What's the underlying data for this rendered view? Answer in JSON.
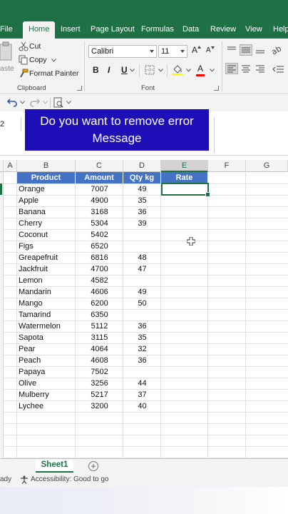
{
  "tabs": [
    "File",
    "Home",
    "Insert",
    "Page Layout",
    "Formulas",
    "Data",
    "Review",
    "View",
    "Help"
  ],
  "ribbon": {
    "clipboard": {
      "paste_label": "aste",
      "cut_label": "Cut",
      "copy_label": "Copy",
      "format_painter_label": "Format Painter",
      "group_label": "Clipboard"
    },
    "font": {
      "font_name": "Calibri",
      "font_size": "11",
      "bold": "B",
      "italic": "I",
      "underline": "U",
      "grow_label": "A",
      "shrink_label": "A",
      "font_color_label": "A",
      "group_label": "Font"
    }
  },
  "formula_bar": {
    "name_box": "2"
  },
  "banner": {
    "line1": "Do  you want to remove error",
    "line2": "Message"
  },
  "grid": {
    "columns": [
      "A",
      "B",
      "C",
      "D",
      "E",
      "F",
      "G"
    ],
    "selected_column": "E",
    "headers": [
      "Product",
      "Amount",
      "Qty kg",
      "Rate"
    ],
    "rows": [
      {
        "product": "Orange",
        "amount": "7007",
        "qty": "49"
      },
      {
        "product": "Apple",
        "amount": "4900",
        "qty": "35"
      },
      {
        "product": "Banana",
        "amount": "3168",
        "qty": "36"
      },
      {
        "product": "Cherry",
        "amount": "5304",
        "qty": "39"
      },
      {
        "product": "Coconut",
        "amount": "5402",
        "qty": ""
      },
      {
        "product": "Figs",
        "amount": "6520",
        "qty": ""
      },
      {
        "product": "Greapefruit",
        "amount": "6816",
        "qty": "48"
      },
      {
        "product": "Jackfruit",
        "amount": "4700",
        "qty": "47"
      },
      {
        "product": "Lemon",
        "amount": "4582",
        "qty": ""
      },
      {
        "product": "Mandarin",
        "amount": "4606",
        "qty": "49"
      },
      {
        "product": "Mango",
        "amount": "6200",
        "qty": "50"
      },
      {
        "product": "Tamarind",
        "amount": "6350",
        "qty": ""
      },
      {
        "product": "Watermelon",
        "amount": "5112",
        "qty": "36"
      },
      {
        "product": "Sapota",
        "amount": "3115",
        "qty": "35"
      },
      {
        "product": "Pear",
        "amount": "4064",
        "qty": "32"
      },
      {
        "product": "Peach",
        "amount": "4608",
        "qty": "36"
      },
      {
        "product": "Papaya",
        "amount": "7502",
        "qty": ""
      },
      {
        "product": "Olive",
        "amount": "3256",
        "qty": "44"
      },
      {
        "product": "Mulberry",
        "amount": "5217",
        "qty": "37"
      },
      {
        "product": "Lychee",
        "amount": "3200",
        "qty": "40"
      }
    ]
  },
  "sheets": {
    "active": "Sheet1",
    "add_label": "+"
  },
  "status": {
    "ready": "ady",
    "accessibility": "Accessibility: Good to go"
  },
  "colors": {
    "excel_green": "#1e7145",
    "header_blue": "#4472c4",
    "banner_blue": "#1d0eb8"
  }
}
